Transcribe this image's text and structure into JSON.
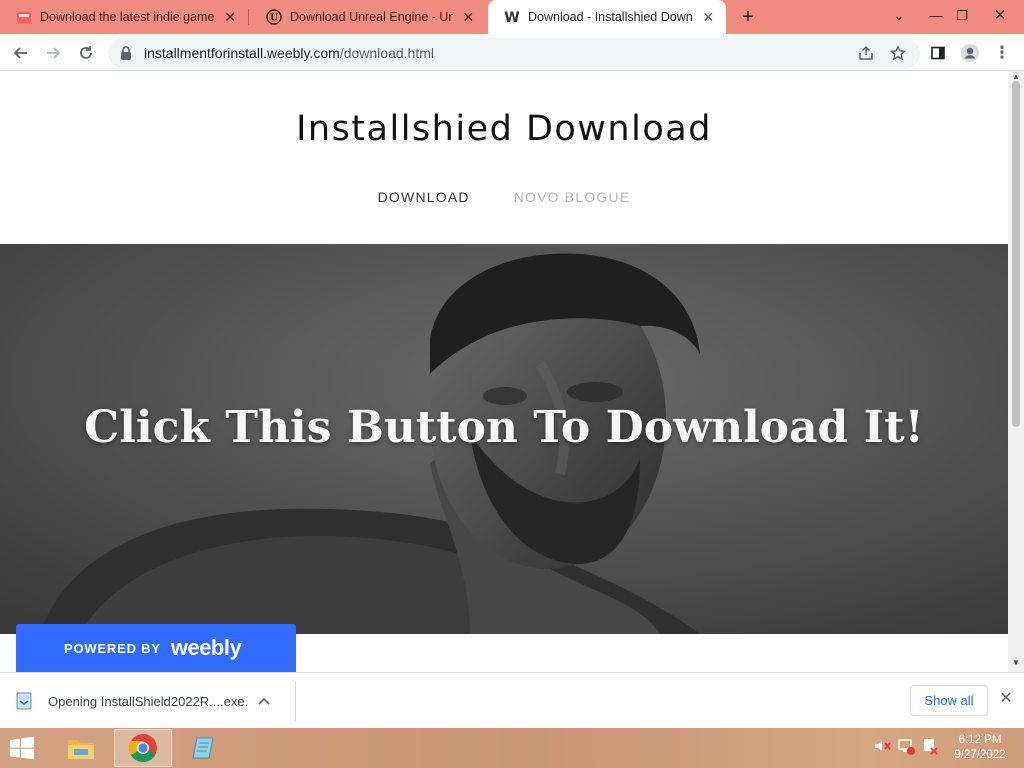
{
  "browser": {
    "tabs": [
      {
        "title": "Download the latest indie games",
        "favicon": "itchio-icon",
        "favicon_color": "#fa5c5c",
        "active": false
      },
      {
        "title": "Download Unreal Engine - Unreal",
        "favicon": "unreal-icon",
        "favicon_color": "#1d1d1d",
        "active": false
      },
      {
        "title": "Download - Installshied Download",
        "favicon": "weebly-icon",
        "favicon_color": "#333333",
        "active": true
      }
    ],
    "new_tab_glyph": "+",
    "url_host": "installmentforinstall.weebly.com",
    "url_path": "/download.html",
    "accent": "#f28b80"
  },
  "page": {
    "site_title": "Installshied Download",
    "nav": [
      {
        "label": "DOWNLOAD",
        "active": true
      },
      {
        "label": "NOVO BLOGUE",
        "active": false
      }
    ],
    "hero_text": "Click This Button To Download It!",
    "weebly_badge": {
      "powered_by": "POWERED BY",
      "brand": "weebly",
      "color": "#2f6bff"
    }
  },
  "download_shelf": {
    "item_label": "Opening InstallShield2022R....exe...",
    "show_all": "Show all"
  },
  "taskbar": {
    "apps": [
      "file-explorer-icon",
      "chrome-icon",
      "notepad-icon"
    ],
    "time": "6:12 PM",
    "date": "9/27/2022"
  }
}
